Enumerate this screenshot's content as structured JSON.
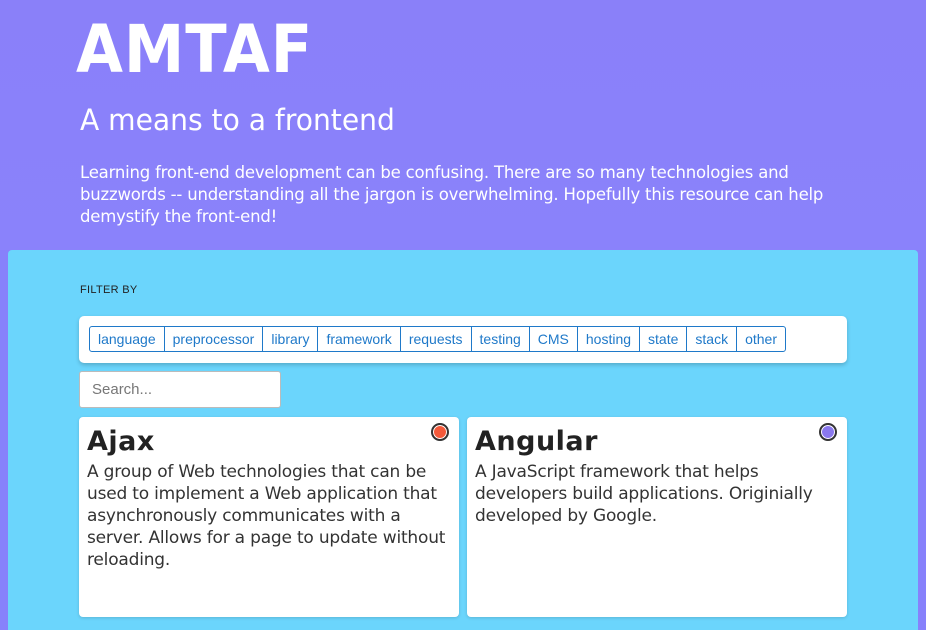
{
  "header": {
    "logo": "AMTAF",
    "tagline": "A means to a frontend",
    "intro": "Learning front-end development can be confusing. There are so many technologies and buzzwords -- understanding all the jargon is overwhelming. Hopefully this resource can help demystify the front-end!"
  },
  "filter": {
    "label": "FILTER BY",
    "buttons": [
      "language",
      "preprocessor",
      "library",
      "framework",
      "requests",
      "testing",
      "CMS",
      "hosting",
      "state",
      "stack",
      "other"
    ]
  },
  "search": {
    "placeholder": "Search..."
  },
  "cards": [
    {
      "title": "Ajax",
      "description": "A group of Web technologies that can be used to implement a Web application that asynchronously communicates with a server. Allows for a page to update without reloading.",
      "category_color": "#f4593a"
    },
    {
      "title": "Angular",
      "description": "A JavaScript framework that helps developers build applications. Originially developed by Google.",
      "category_color": "#8a78ee"
    }
  ],
  "colors": {
    "header_bg": "#8a82fb",
    "panel_bg": "#6bd5fc",
    "filter_accent": "#1f79c9"
  }
}
